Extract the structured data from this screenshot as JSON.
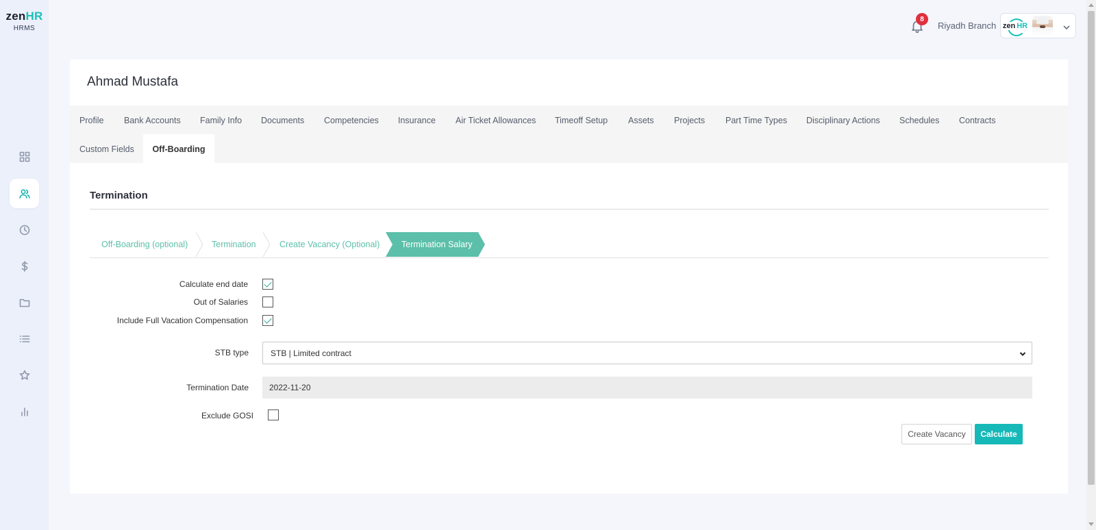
{
  "brand": {
    "word_main": "zen",
    "word_accent": "HR",
    "sub": "HRMS",
    "accent_color": "#19c0bb"
  },
  "sidebar": {
    "items": [
      {
        "icon": "dashboard-icon",
        "active": false
      },
      {
        "icon": "users-icon",
        "active": true
      },
      {
        "icon": "clock-icon",
        "active": false
      },
      {
        "icon": "dollar-icon",
        "active": false
      },
      {
        "icon": "folder-icon",
        "active": false
      },
      {
        "icon": "list-icon",
        "active": false
      },
      {
        "icon": "star-icon",
        "active": false
      },
      {
        "icon": "bar-chart-icon",
        "active": false
      }
    ]
  },
  "header": {
    "notification_count": "8",
    "branch": "Riyadh Branch",
    "mini_logo_main": "zen",
    "mini_logo_accent": "HR"
  },
  "employee": {
    "name": "Ahmad Mustafa"
  },
  "tabs": [
    {
      "label": "Profile"
    },
    {
      "label": "Bank Accounts"
    },
    {
      "label": "Family Info"
    },
    {
      "label": "Documents"
    },
    {
      "label": "Competencies"
    },
    {
      "label": "Insurance"
    },
    {
      "label": "Air Ticket Allowances"
    },
    {
      "label": "Timeoff Setup"
    },
    {
      "label": "Assets"
    },
    {
      "label": "Projects"
    },
    {
      "label": "Part Time Types"
    },
    {
      "label": "Disciplinary Actions"
    },
    {
      "label": "Schedules"
    },
    {
      "label": "Contracts"
    },
    {
      "label": "Custom Fields"
    },
    {
      "label": "Off-Boarding",
      "active": true
    }
  ],
  "section": {
    "title": "Termination"
  },
  "wizard": {
    "steps": [
      {
        "label": "Off-Boarding (optional)"
      },
      {
        "label": "Termination"
      },
      {
        "label": "Create Vacancy (Optional)"
      },
      {
        "label": "Termination Salary",
        "active": true
      }
    ],
    "active_color": "#5cbfa9"
  },
  "form": {
    "calculate_end_date": {
      "label": "Calculate end date",
      "checked": true
    },
    "out_of_salaries": {
      "label": "Out of Salaries",
      "checked": false
    },
    "include_full_vacation": {
      "label": "Include Full Vacation Compensation",
      "checked": true
    },
    "stb_type": {
      "label": "STB type",
      "value": "STB | Limited contract"
    },
    "termination_date": {
      "label": "Termination Date",
      "value": "2022-11-20"
    },
    "exclude_gosi": {
      "label": "Exclude GOSI",
      "checked": false
    }
  },
  "actions": {
    "create_vacancy": "Create Vacancy",
    "calculate": "Calculate",
    "primary_color": "#16b8b8"
  }
}
